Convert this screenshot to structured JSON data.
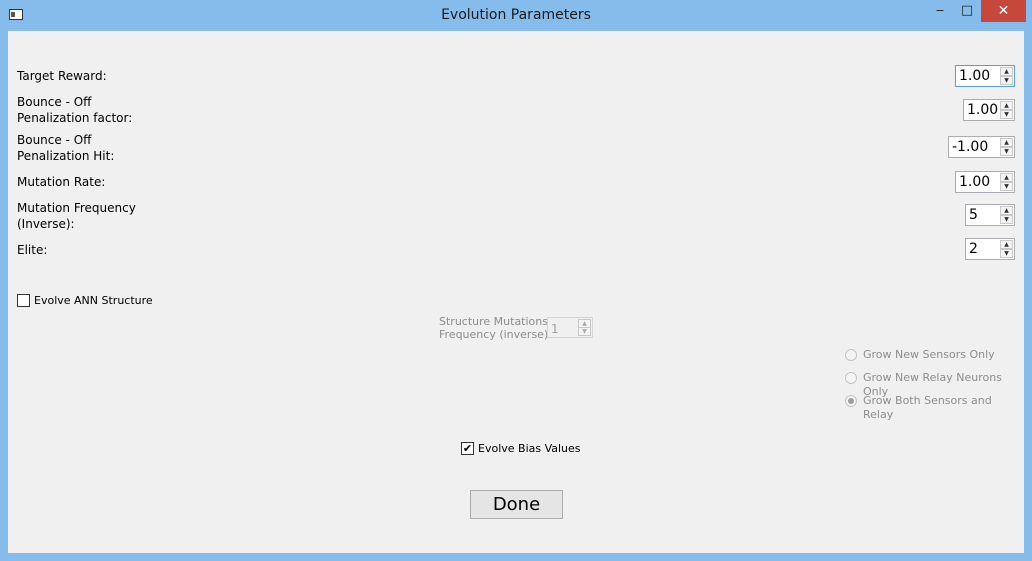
{
  "window": {
    "title": "Evolution Parameters",
    "minimize": "‒",
    "maximize": "□",
    "close": "✕"
  },
  "params": [
    {
      "label": "Target Reward:",
      "value": "1.00"
    },
    {
      "label": "Bounce - Off\nPenalization factor:",
      "value": "1.00"
    },
    {
      "label": "Bounce - Off\nPenalization Hit:",
      "value": "-1.00"
    },
    {
      "label": "Mutation Rate:",
      "value": "1.00"
    },
    {
      "label": "Mutation Frequency\n(Inverse):",
      "value": "5"
    },
    {
      "label": "Elite:",
      "value": "2"
    }
  ],
  "evolve_structure": {
    "label": "Evolve ANN Structure",
    "checked": false
  },
  "structure_mutations": {
    "label": "Structure Mutations\nFrequency (inverse):",
    "value": "1"
  },
  "grow_options": [
    {
      "label": "Grow New Sensors Only",
      "checked": false
    },
    {
      "label": "Grow New Relay Neurons Only",
      "checked": false
    },
    {
      "label": "Grow Both Sensors and Relay",
      "checked": true
    }
  ],
  "evolve_bias": {
    "label": "Evolve Bias Values",
    "checked": true,
    "mark": "✔"
  },
  "done_label": "Done",
  "spin_arrows": {
    "up": "▲",
    "down": "▼"
  }
}
